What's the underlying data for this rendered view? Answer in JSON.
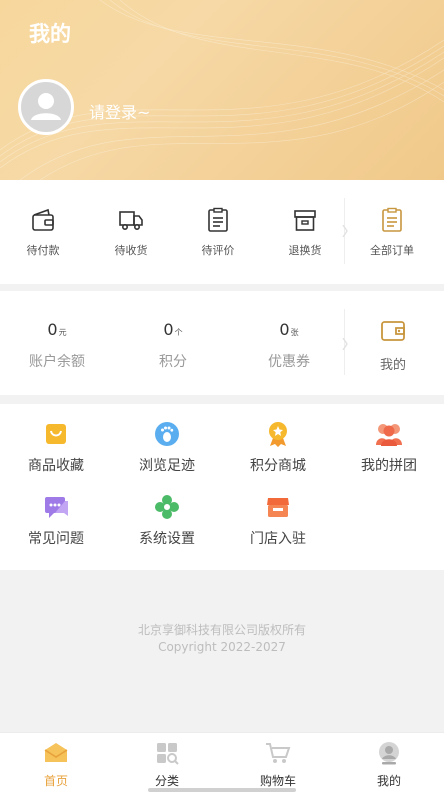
{
  "header": {
    "title": "我的",
    "login_prompt": "请登录~"
  },
  "orders": {
    "items": [
      {
        "label": "待付款",
        "icon": "wallet-icon"
      },
      {
        "label": "待收货",
        "icon": "delivery-truck-icon"
      },
      {
        "label": "待评价",
        "icon": "review-clipboard-icon"
      },
      {
        "label": "退换货",
        "icon": "return-box-icon"
      }
    ],
    "all_orders": {
      "label": "全部订单",
      "icon": "orders-list-icon"
    }
  },
  "wallet": {
    "items": [
      {
        "value": "0",
        "unit": "元",
        "label": "账户余额"
      },
      {
        "value": "0",
        "unit": "个",
        "label": "积分"
      },
      {
        "value": "0",
        "unit": "张",
        "label": "优惠券"
      }
    ],
    "mine": {
      "label": "我的",
      "icon": "wallet-icon"
    }
  },
  "tools": {
    "items": [
      {
        "label": "商品收藏",
        "icon": "favorites-bag-icon"
      },
      {
        "label": "浏览足迹",
        "icon": "footprint-icon"
      },
      {
        "label": "积分商城",
        "icon": "medal-icon"
      },
      {
        "label": "我的拼团",
        "icon": "group-users-icon"
      },
      {
        "label": "常见问题",
        "icon": "chat-bubble-icon"
      },
      {
        "label": "系统设置",
        "icon": "flower-settings-icon"
      },
      {
        "label": "门店入驻",
        "icon": "store-icon"
      }
    ]
  },
  "footer": {
    "company": "北京享御科技有限公司版权所有",
    "copyright": "Copyright 2022-2027"
  },
  "tabbar": {
    "items": [
      {
        "label": "首页",
        "icon": "home-envelope-icon",
        "active": true
      },
      {
        "label": "分类",
        "icon": "category-grid-icon",
        "active": false
      },
      {
        "label": "购物车",
        "icon": "cart-icon",
        "active": false
      },
      {
        "label": "我的",
        "icon": "profile-icon",
        "active": false
      }
    ]
  },
  "colors": {
    "accent": "#e8a23b",
    "header_gradient_start": "#f7d79c",
    "header_gradient_end": "#f0c98a",
    "wallet_icon": "#c8963e"
  }
}
